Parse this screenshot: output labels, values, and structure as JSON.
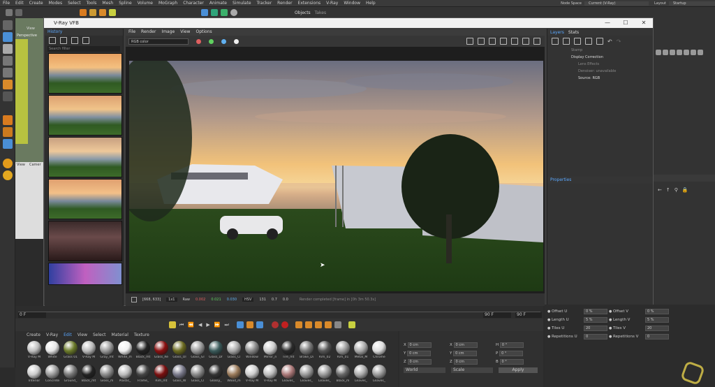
{
  "c4d": {
    "menu": [
      "File",
      "Edit",
      "Create",
      "Modes",
      "Select",
      "Tools",
      "Mesh",
      "Spline",
      "Volume",
      "MoGraph",
      "Character",
      "Animate",
      "Simulate",
      "Tracker",
      "Render",
      "Extensions",
      "V-Ray",
      "Window",
      "Help"
    ],
    "node_space_label": "Node Space",
    "node_space_value": "Current (V-Ray)",
    "layout_label": "Layout",
    "layout_value": "Startup",
    "tabs_right": [
      "Objects",
      "Takes"
    ],
    "viewport_label": "Perspective",
    "view_tab": "View",
    "viewport2_tabs": [
      "View",
      "Camer"
    ]
  },
  "vfb": {
    "title": "V-Ray VFB",
    "win_buttons": [
      "—",
      "☐",
      "✕"
    ],
    "history_tab": "History",
    "search_placeholder": "Search filter",
    "menu": [
      "File",
      "Render",
      "Image",
      "View",
      "Options"
    ],
    "channel": "RGB color",
    "coords": "[668, 633]",
    "zoom": "1x1",
    "mode": "Raw",
    "r": "0.002",
    "g": "0.021",
    "b": "0.030",
    "color_space": "HSV",
    "h": "131",
    "s": "0.7",
    "v": "0.0",
    "status": "Render completed [frame] in [0h 3m 50.3s]",
    "layers_tabs": [
      "Layers",
      "Stats"
    ],
    "layers": [
      "Stamp",
      "Display Correction",
      "Lens Effects",
      "Denoiser: unavailable",
      "Source: RGB"
    ],
    "properties": "Properties"
  },
  "timeline": {
    "start": "0 F",
    "end": "90 F",
    "end2": "90 F",
    "ticks": [
      "0",
      "5",
      "10",
      "15",
      "20",
      "25",
      "30",
      "35",
      "40",
      "45",
      "50",
      "55",
      "60",
      "65",
      "70",
      "75",
      "80",
      "85",
      "90"
    ]
  },
  "materials": {
    "menu": [
      "Create",
      "V-Ray",
      "Edit",
      "View",
      "Select",
      "Material",
      "Texture"
    ],
    "row1": [
      "V-Ray M",
      "White",
      "Grass 01",
      "V-Ray M",
      "Gray_mt",
      "White_m",
      "Black_mt",
      "Glass_Re",
      "Glass_Ol",
      "Glass_Gl",
      "Glass_Dr",
      "Glass_Cl",
      "Window",
      "Mirror_n",
      "Tire_mt",
      "Brake_Di",
      "Rim_02",
      "Rim_01",
      "Metal_M",
      "Chrome"
    ],
    "row2": [
      "Interior",
      "Concrete",
      "Ground_",
      "Black_mt",
      "Gloss_m",
      "Plastic_",
      "Frame_",
      "Rim_mt",
      "Glass_W",
      "Glass_Cl",
      "Glossy_",
      "Wood_m",
      "V-Ray M",
      "V-Ray M",
      "Leaves_",
      "Leaves_",
      "Leaves_",
      "Black_m",
      "Leaves_",
      "Leaves_"
    ],
    "colors1": [
      "#bfbfbf",
      "#e6e6e6",
      "#6b7a2a",
      "#bcbcbc",
      "#9a9a9a",
      "#f0f0f0",
      "#222",
      "#8a1010",
      "#6b6a20",
      "#999",
      "#3a5a5a",
      "#aaa",
      "#888",
      "#ccc",
      "#2a2a2a",
      "#777",
      "#555",
      "#999",
      "#aaa",
      "#ddd"
    ],
    "colors2": [
      "#ccc",
      "#999",
      "#777",
      "#222",
      "#8a8a8a",
      "#bbb",
      "#444",
      "#7a0f0f",
      "#778",
      "#888",
      "#333",
      "#9a7a5a",
      "#ccc",
      "#bbb",
      "#a77",
      "#999",
      "#999",
      "#666",
      "#aaa",
      "#999"
    ]
  },
  "coords": {
    "labels": [
      "X",
      "Y",
      "Z"
    ],
    "values_pos": [
      "0 cm",
      "0 cm",
      "0 cm"
    ],
    "labels2": [
      "X",
      "Y",
      "Z"
    ],
    "values_size": [
      "0 cm",
      "0 cm",
      "0 cm"
    ],
    "labels3": [
      "H",
      "P",
      "B"
    ],
    "values_rot": [
      "0 °",
      "0 °",
      "0 °"
    ],
    "world": "World",
    "scale": "Scale",
    "apply": "Apply"
  },
  "attributes": {
    "left": [
      {
        "label": "Offset U",
        "value": "0 %"
      },
      {
        "label": "Length U",
        "value": "5 %"
      },
      {
        "label": "Tiles U",
        "value": "20"
      },
      {
        "label": "Repetitions U",
        "value": "0"
      }
    ],
    "right": [
      {
        "label": "Offset V",
        "value": "0 %"
      },
      {
        "label": "Length V",
        "value": "5 %"
      },
      {
        "label": "Tiles V",
        "value": "20"
      },
      {
        "label": "Repetitions V",
        "value": "0"
      }
    ]
  }
}
